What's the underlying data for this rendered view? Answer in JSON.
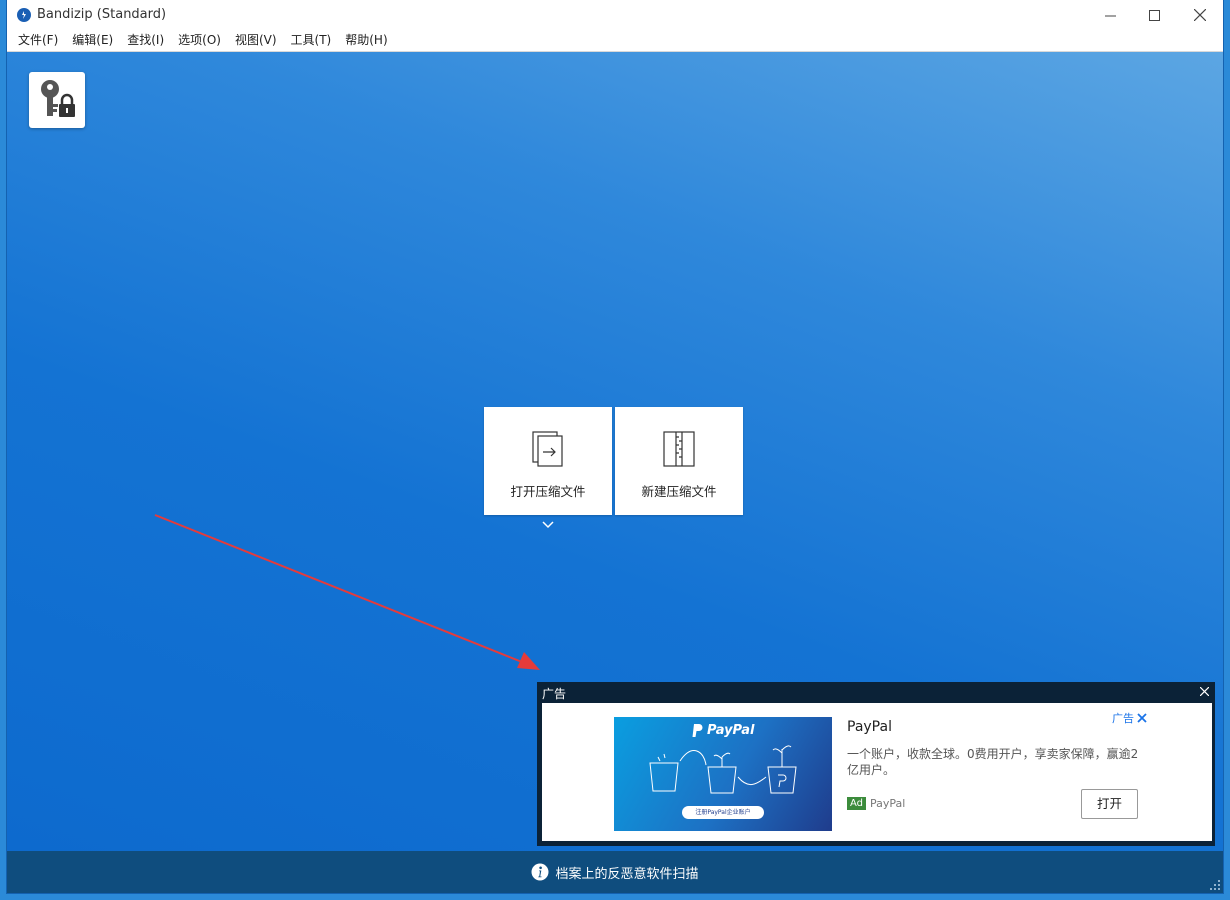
{
  "window": {
    "title": "Bandizip (Standard)",
    "controls": {
      "minimize": "minimize",
      "maximize": "maximize",
      "close": "close"
    }
  },
  "menu": [
    {
      "label": "文件(F)"
    },
    {
      "label": "编辑(E)"
    },
    {
      "label": "查找(I)"
    },
    {
      "label": "选项(O)"
    },
    {
      "label": "视图(V)"
    },
    {
      "label": "工具(T)"
    },
    {
      "label": "帮助(H)"
    }
  ],
  "tiles": {
    "open": {
      "label": "打开压缩文件",
      "icon": "open-archive-icon"
    },
    "create": {
      "label": "新建压缩文件",
      "icon": "new-archive-icon"
    }
  },
  "ad": {
    "header": "广告",
    "image_brand": "PayPal",
    "image_button": "注册PayPal企业账户",
    "title": "PayPal",
    "description": "一个账户，收款全球。0费用开户，享卖家保障，赢逾2亿用户。",
    "badge": "Ad",
    "brand": "PayPal",
    "choice_label": "广告",
    "button": "打开"
  },
  "status": {
    "text": "档案上的反恶意软件扫描",
    "icon": "info-icon"
  },
  "colors": {
    "accent": "#1b7ad3",
    "statusbar": "#0f4d7e",
    "ad_background": "#0b2237",
    "arrow": "#e53b3b"
  }
}
